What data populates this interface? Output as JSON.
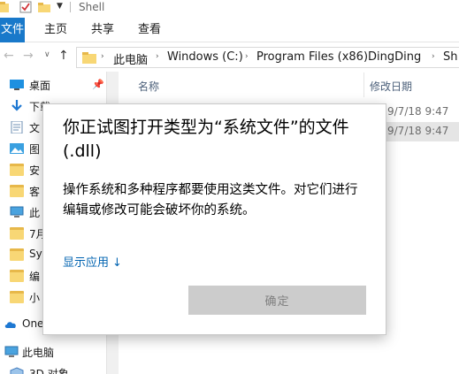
{
  "window": {
    "title": "Shell"
  },
  "ribbon": {
    "tabs": [
      "文件",
      "主页",
      "共享",
      "查看"
    ]
  },
  "address": {
    "crumbs": [
      "此电脑",
      "Windows (C:)",
      "Program Files (x86)",
      "DingDing",
      "Sh"
    ]
  },
  "nav_pane": {
    "items": [
      {
        "label": "桌面",
        "icon": "desktop-icon",
        "pinned": true
      },
      {
        "label": "下载",
        "icon": "download-arrow-icon"
      },
      {
        "label": "文",
        "icon": "document-icon"
      },
      {
        "label": "图",
        "icon": "picture-icon"
      },
      {
        "label": "安",
        "icon": "folder-icon"
      },
      {
        "label": "客",
        "icon": "folder-icon"
      },
      {
        "label": "此",
        "icon": "monitor-icon"
      },
      {
        "label": "7月",
        "icon": "folder-icon"
      },
      {
        "label": "Sy",
        "icon": "folder-icon"
      },
      {
        "label": "编",
        "icon": "folder-icon"
      },
      {
        "label": "小",
        "icon": "folder-icon"
      },
      {
        "label": "One",
        "icon": "cloud-icon"
      },
      {
        "label": "此电脑",
        "icon": "monitor-icon"
      },
      {
        "label": "3D 对象",
        "icon": "3d-objects-icon"
      }
    ]
  },
  "file_list": {
    "columns": {
      "name": "名称",
      "date": "修改日期"
    },
    "rows": [
      {
        "date": "9/7/18 9:47",
        "selected": false
      },
      {
        "date": "9/7/18 9:47",
        "selected": true
      }
    ]
  },
  "dialog": {
    "title": "你正试图打开类型为“系统文件”的文件(.dll)",
    "body": "操作系统和多种程序都要使用这类文件。对它们进行编辑或修改可能会破坏你的系统。",
    "show_apps_link": "显示应用",
    "show_apps_arrow": "↓",
    "ok_button": "确定"
  },
  "colors": {
    "accent": "#1979ca",
    "link": "#0063b1",
    "selection": "#e5e5e5",
    "disabled_button": "#cccccc"
  }
}
